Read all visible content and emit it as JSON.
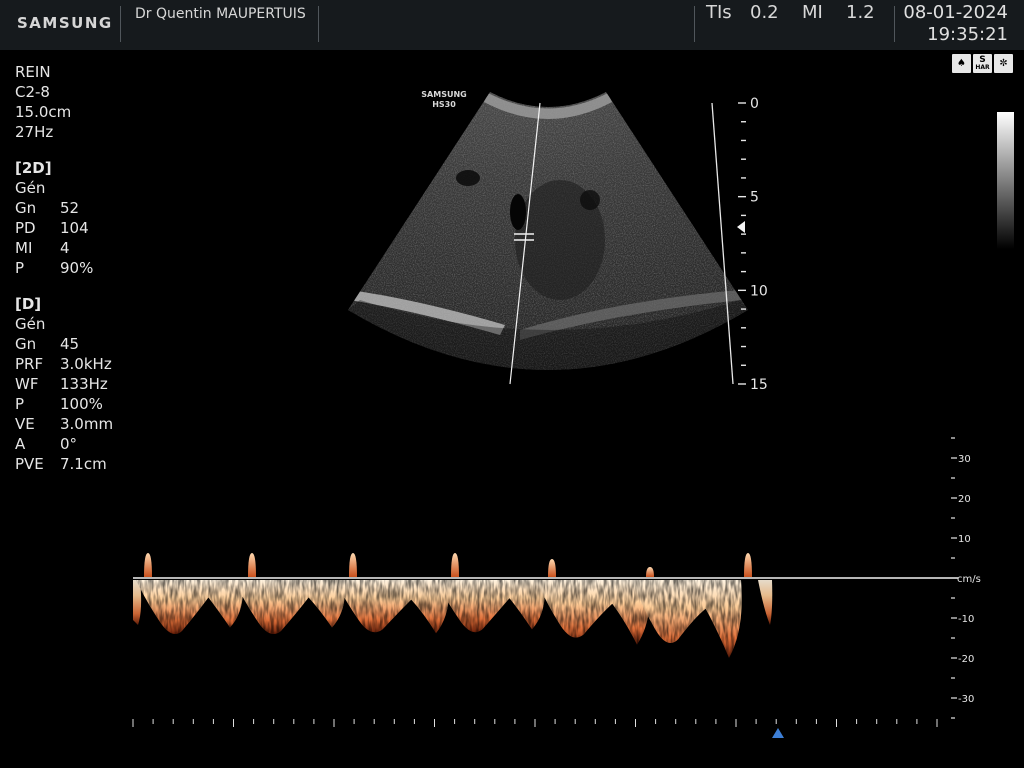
{
  "header": {
    "brand": "SAMSUNG",
    "physician": "Dr Quentin MAUPERTUIS",
    "tis_label": "TIs",
    "tis_value": "0.2",
    "mi_label": "MI",
    "mi_value": "1.2",
    "date": "08-01-2024",
    "time": "19:35:21"
  },
  "params": {
    "preset": "REIN",
    "probe": "C2-8",
    "depth": "15.0cm",
    "frame_rate": "27Hz",
    "mode_2d": {
      "header": "[2D]",
      "mode": "Gén",
      "rows": [
        {
          "key": "Gn",
          "value": "52"
        },
        {
          "key": "PD",
          "value": "104"
        },
        {
          "key": "MI",
          "value": "4"
        },
        {
          "key": "P",
          "value": "90%"
        }
      ]
    },
    "mode_d": {
      "header": "[D]",
      "mode": "Gén",
      "rows": [
        {
          "key": "Gn",
          "value": "45"
        },
        {
          "key": "PRF",
          "value": "3.0kHz"
        },
        {
          "key": "WF",
          "value": "133Hz"
        },
        {
          "key": "P",
          "value": "100%"
        },
        {
          "key": "VE",
          "value": "3.0mm"
        },
        {
          "key": "A",
          "value": "0°"
        },
        {
          "key": "PVE",
          "value": "7.1cm"
        }
      ]
    }
  },
  "image": {
    "watermark_line1": "SAMSUNG",
    "watermark_line2": "HS30",
    "depth_scale_labels": [
      "0",
      "5",
      "10",
      "15"
    ]
  },
  "status_icons": [
    "probe-icon",
    "shar-icon",
    "film-reel-icon"
  ],
  "status_icon_text": {
    "s": "S",
    "har": "HAR"
  },
  "doppler": {
    "velocity_unit": "cm/s",
    "velocity_labels": [
      "30",
      "20",
      "10",
      "-10",
      "-20",
      "-30"
    ],
    "baseline_velocity": 0
  }
}
